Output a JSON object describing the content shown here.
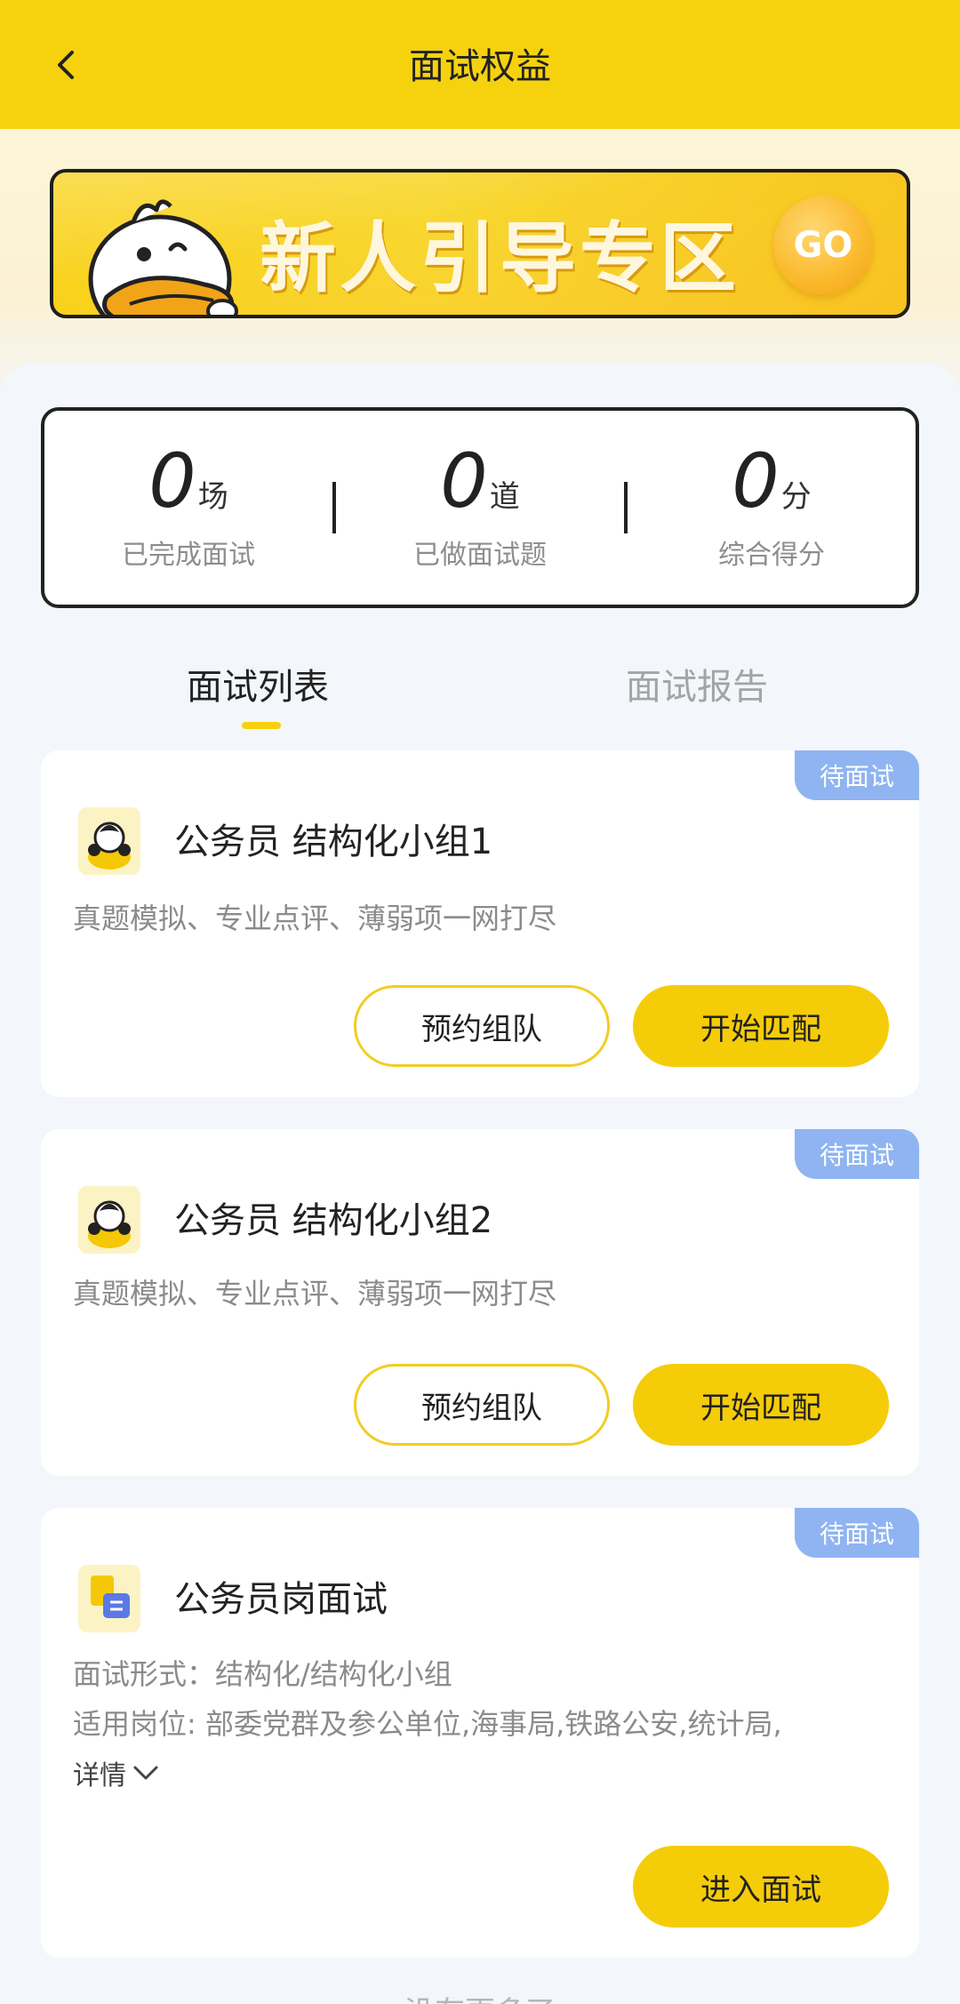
{
  "header": {
    "title": "面试权益"
  },
  "banner": {
    "text": "新人引导专区",
    "go_label": "GO"
  },
  "stats": [
    {
      "value": "0",
      "unit": "场",
      "label": "已完成面试"
    },
    {
      "value": "0",
      "unit": "道",
      "label": "已做面试题"
    },
    {
      "value": "0",
      "unit": "分",
      "label": "综合得分"
    }
  ],
  "tabs": [
    {
      "label": "面试列表",
      "active": true
    },
    {
      "label": "面试报告",
      "active": false
    }
  ],
  "cards": [
    {
      "badge": "待面试",
      "title": "公务员 结构化小组1",
      "desc": "真题模拟、专业点评、薄弱项一网打尽",
      "btn_reserve": "预约组队",
      "btn_match": "开始匹配"
    },
    {
      "badge": "待面试",
      "title": "公务员 结构化小组2",
      "desc": "真题模拟、专业点评、薄弱项一网打尽",
      "btn_reserve": "预约组队",
      "btn_match": "开始匹配"
    },
    {
      "badge": "待面试",
      "title": "公务员岗面试",
      "form_line": "面试形式：结构化/结构化小组",
      "post_line": "适用岗位: 部委党群及参公单位,海事局,铁路公安,统计局,",
      "detail_label": "详情",
      "btn_enter": "进入面试"
    }
  ],
  "footer": {
    "text": "没有更多了"
  },
  "colors": {
    "brand_yellow": "#f6d20e",
    "badge_blue": "#8fb4f1",
    "bg": "#f3f6fb"
  }
}
